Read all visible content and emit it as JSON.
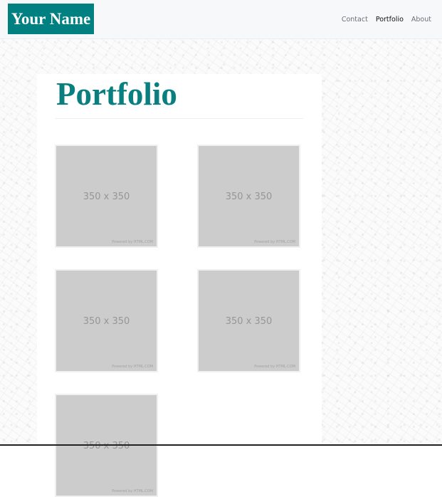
{
  "navbar": {
    "brand": "Your Name",
    "links": [
      {
        "label": "Contact",
        "active": false
      },
      {
        "label": "Portfolio",
        "active": true
      },
      {
        "label": "About",
        "active": false
      }
    ]
  },
  "main": {
    "title": "Portfolio",
    "thumbnails": [
      {
        "label": "350 x 350",
        "credit": "Powered by HTML.COM"
      },
      {
        "label": "350 x 350",
        "credit": "Powered by HTML.COM"
      },
      {
        "label": "350 x 350",
        "credit": "Powered by HTML.COM"
      },
      {
        "label": "350 x 350",
        "credit": "Powered by HTML.COM"
      },
      {
        "label": "350 x 350",
        "credit": "Powered by HTML.COM"
      }
    ]
  },
  "colors": {
    "brand_bg": "#008080",
    "title": "#0a7f7f",
    "placeholder": "#cccccc"
  }
}
